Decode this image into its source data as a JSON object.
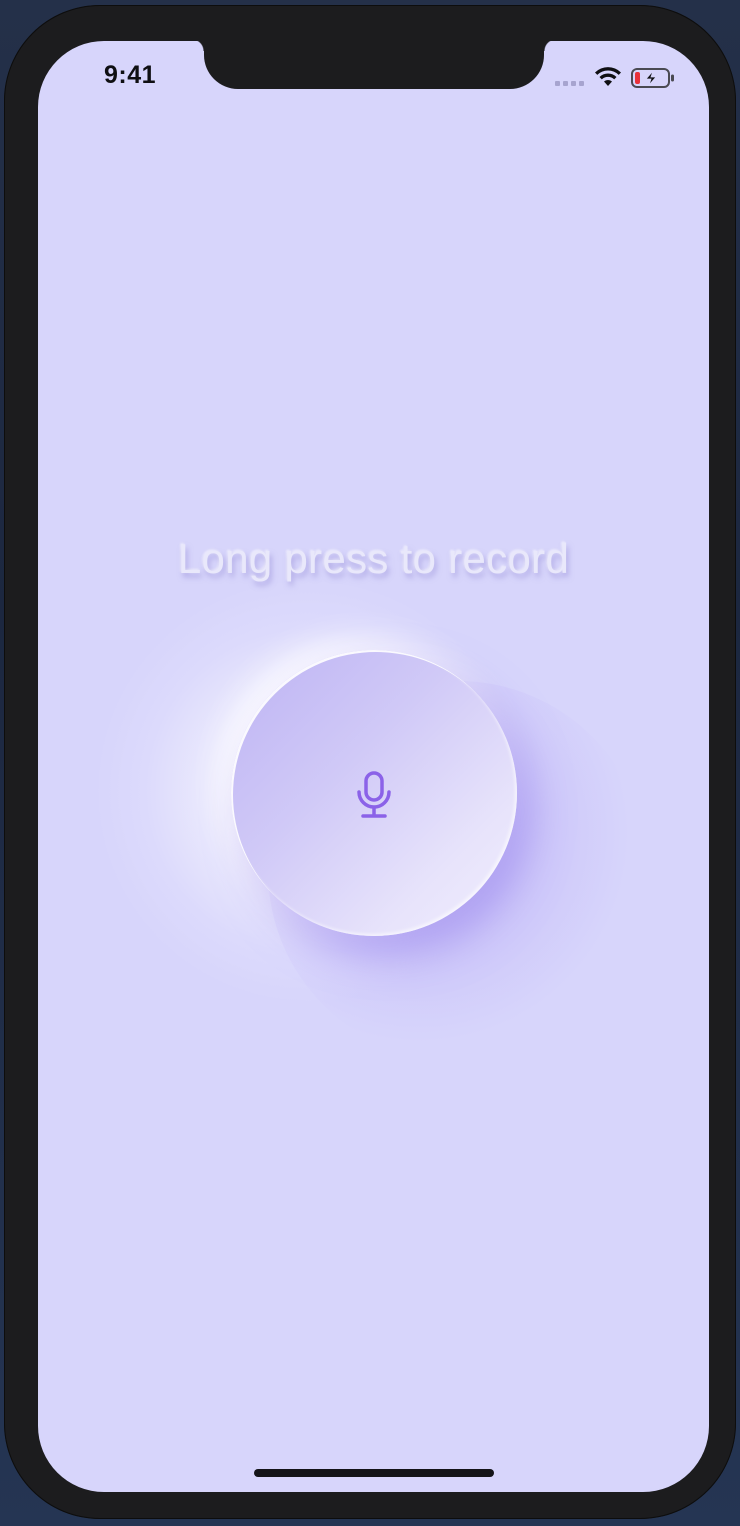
{
  "status_bar": {
    "time": "9:41",
    "icons": [
      "signal-icon",
      "wifi-icon",
      "battery-charging-icon"
    ]
  },
  "recorder": {
    "hint": "Long press to record",
    "button_icon": "microphone-icon"
  },
  "colors": {
    "background": "#d7d5fb",
    "accent": "#8b62e8",
    "hint_text": "#e9e8fb"
  }
}
